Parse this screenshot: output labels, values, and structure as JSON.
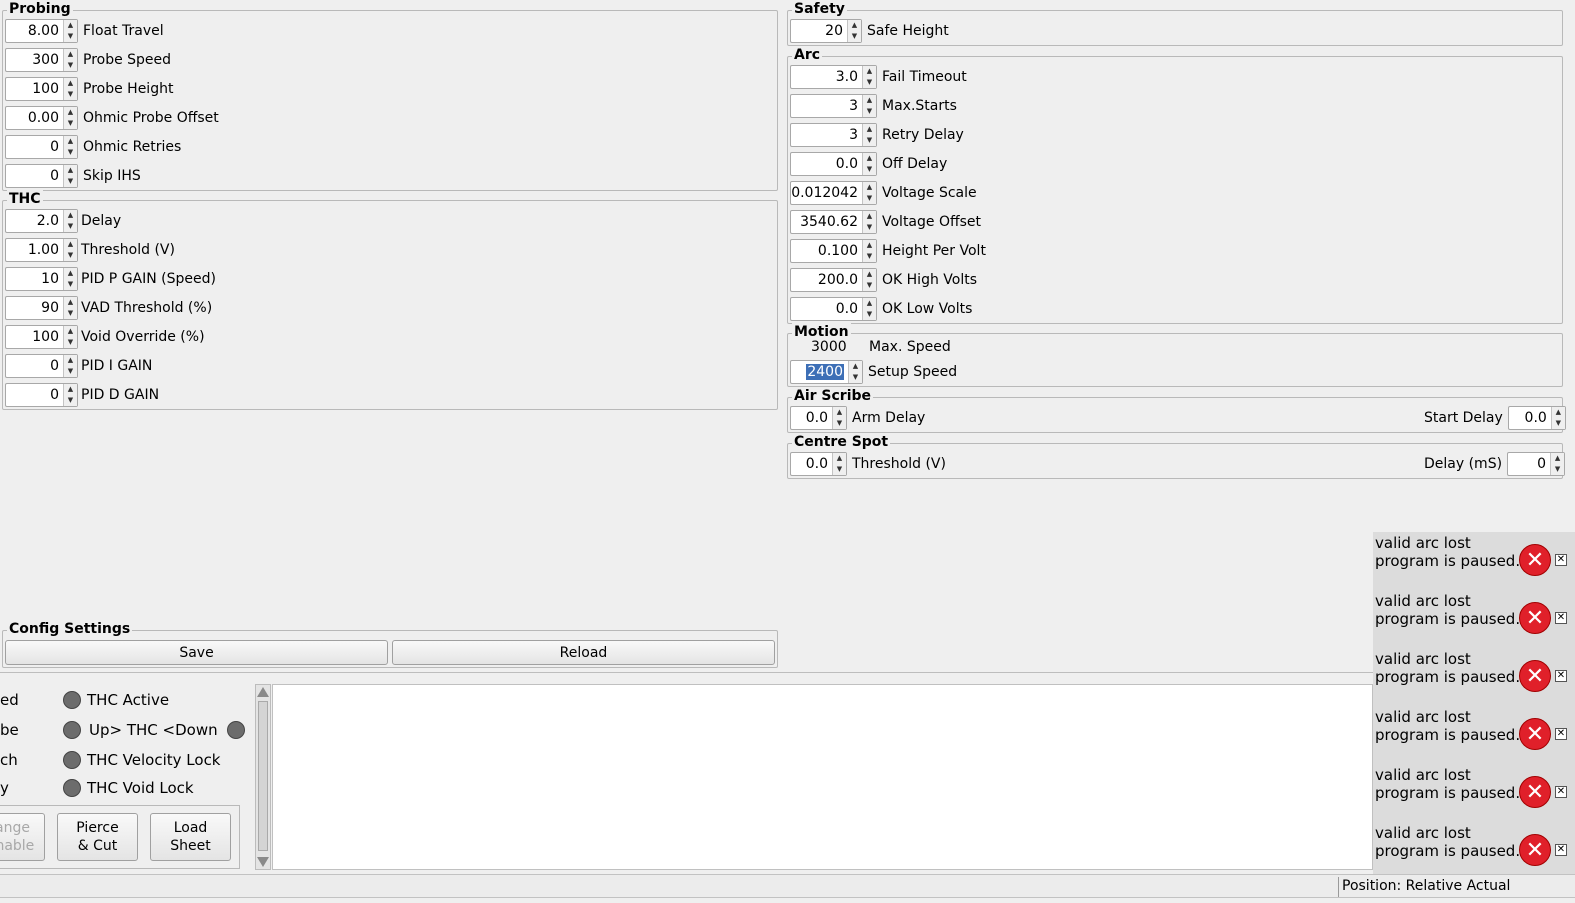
{
  "probing": {
    "title": "Probing",
    "rows": [
      {
        "value": "8.00",
        "label": "Float Travel"
      },
      {
        "value": "300",
        "label": "Probe Speed"
      },
      {
        "value": "100",
        "label": "Probe Height"
      },
      {
        "value": "0.00",
        "label": "Ohmic Probe Offset"
      },
      {
        "value": "0",
        "label": "Ohmic Retries"
      },
      {
        "value": "0",
        "label": "Skip IHS"
      }
    ]
  },
  "thc": {
    "title": "THC",
    "rows": [
      {
        "value": "2.0",
        "label": "Delay"
      },
      {
        "value": "1.00",
        "label": "Threshold (V)"
      },
      {
        "value": "10",
        "label": "PID P GAIN (Speed)"
      },
      {
        "value": "90",
        "label": "VAD Threshold (%)"
      },
      {
        "value": "100",
        "label": "Void Override (%)"
      },
      {
        "value": "0",
        "label": "PID I GAIN"
      },
      {
        "value": "0",
        "label": "PID D GAIN"
      }
    ]
  },
  "safety": {
    "title": "Safety",
    "value": "20",
    "label": "Safe Height"
  },
  "arc": {
    "title": "Arc",
    "rows": [
      {
        "value": "3.0",
        "label": "Fail Timeout"
      },
      {
        "value": "3",
        "label": "Max.Starts"
      },
      {
        "value": "3",
        "label": "Retry Delay"
      },
      {
        "value": "0.0",
        "label": "Off Delay"
      },
      {
        "value": "0.012042",
        "label": "Voltage Scale"
      },
      {
        "value": "3540.62",
        "label": "Voltage Offset"
      },
      {
        "value": "0.100",
        "label": "Height Per Volt"
      },
      {
        "value": "200.0",
        "label": "OK High Volts"
      },
      {
        "value": "0.0",
        "label": "OK Low Volts"
      }
    ]
  },
  "motion": {
    "title": "Motion",
    "max_speed_value": "3000",
    "max_speed_label": "Max. Speed",
    "setup_speed_value": "2400",
    "setup_speed_label": "Setup Speed"
  },
  "air_scribe": {
    "title": "Air Scribe",
    "arm_delay_value": "0.0",
    "arm_delay_label": "Arm Delay",
    "start_delay_label": "Start Delay",
    "start_delay_value": "0.0"
  },
  "centre_spot": {
    "title": "Centre Spot",
    "threshold_value": "0.0",
    "threshold_label": "Threshold (V)",
    "delay_label": "Delay (mS)",
    "delay_value": "0"
  },
  "config": {
    "title": "Config Settings",
    "save": "Save",
    "reload": "Reload"
  },
  "left_clipped": [
    "ed",
    "be",
    "ch",
    "y"
  ],
  "leds": [
    "THC Active",
    "Up> THC <Down",
    "THC Velocity Lock",
    "THC Void Lock"
  ],
  "buttons": {
    "change_line1": "ange",
    "change_line2": "mable",
    "pierce_line1": "Pierce",
    "pierce_line2": "& Cut",
    "load_line1": "Load",
    "load_line2": "Sheet"
  },
  "toasts": [
    {
      "line1": "valid arc lost",
      "line2": "program is paused."
    },
    {
      "line1": "valid arc lost",
      "line2": "program is paused."
    },
    {
      "line1": "valid arc lost",
      "line2": "program is paused."
    },
    {
      "line1": "valid arc lost",
      "line2": "program is paused."
    },
    {
      "line1": "valid arc lost",
      "line2": "program is paused."
    },
    {
      "line1": "valid arc lost",
      "line2": "program is paused."
    }
  ],
  "status": {
    "position": "Position: Relative Actual"
  }
}
